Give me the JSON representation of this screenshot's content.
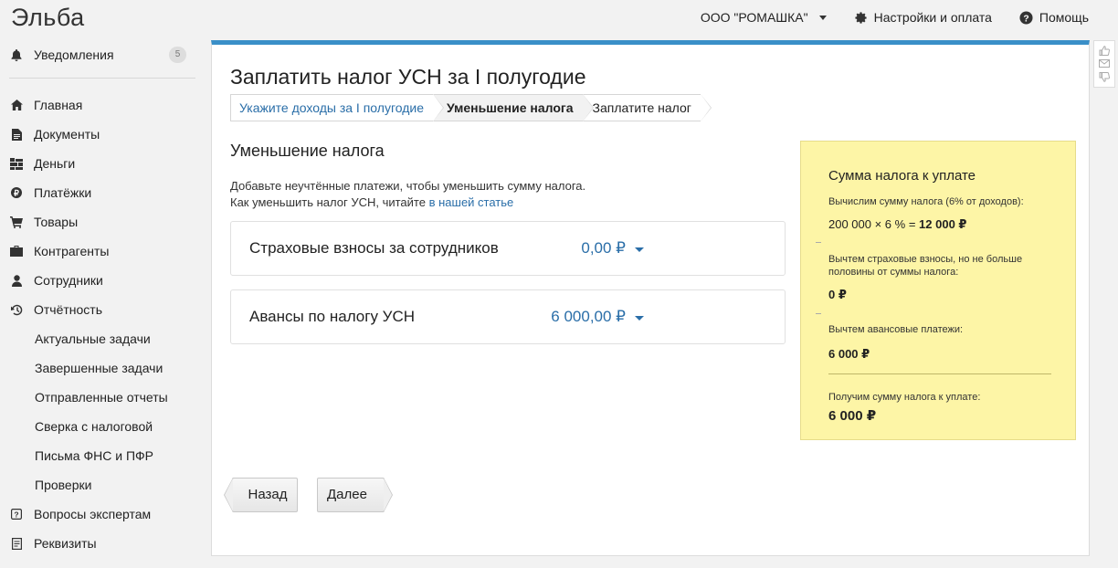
{
  "app": {
    "logo": "Эльба"
  },
  "topnav": {
    "org": "ООО \"РОМАШКА\"",
    "settings": "Настройки и оплата",
    "help": "Помощь"
  },
  "sidebar": {
    "notifications": {
      "label": "Уведомления",
      "badge": "5"
    },
    "items": [
      {
        "label": "Главная",
        "icon": "home-icon"
      },
      {
        "label": "Документы",
        "icon": "documents-icon"
      },
      {
        "label": "Деньги",
        "icon": "money-icon"
      },
      {
        "label": "Платёжки",
        "icon": "payments-icon"
      },
      {
        "label": "Товары",
        "icon": "cart-icon"
      },
      {
        "label": "Контрагенты",
        "icon": "briefcase-icon"
      },
      {
        "label": "Сотрудники",
        "icon": "person-icon"
      },
      {
        "label": "Отчётность",
        "icon": "report-icon"
      }
    ],
    "report_subitems": [
      "Актуальные задачи",
      "Завершенные задачи",
      "Отправленные отчеты",
      "Сверка с налоговой",
      "Письма ФНС и ПФР",
      "Проверки"
    ],
    "bottom_items": [
      {
        "label": "Вопросы экспертам",
        "icon": "question-icon"
      },
      {
        "label": "Реквизиты",
        "icon": "requisites-icon"
      }
    ]
  },
  "main": {
    "title": "Заплатить налог УСН за I полугодие",
    "steps": [
      "Укажите доходы за I полугодие",
      "Уменьшение налога",
      "Заплатите налог"
    ],
    "section_title": "Уменьшение налога",
    "hint_line1": "Добавьте неучтённые платежи, чтобы уменьшить сумму налога.",
    "hint_line2_prefix": "Как уменьшить налог УСН, читайте",
    "hint_link": "в нашей статье",
    "payments": [
      {
        "label": "Страховые взносы за сотрудников",
        "amount": "0,00 ₽"
      },
      {
        "label": "Авансы по налогу УСН",
        "amount": "6 000,00 ₽"
      }
    ],
    "buttons": {
      "back": "Назад",
      "next": "Далее"
    }
  },
  "summary": {
    "title": "Сумма налога к уплате",
    "calc_label": "Вычислим сумму налога (6% от доходов):",
    "formula_prefix": "200 000 × 6 % = ",
    "formula_result": "12 000 ₽",
    "insurance_label": "Вычтем страховые взносы, но не больше половины от суммы налога:",
    "insurance_value": "0 ₽",
    "advance_label": "Вычтем авансовые платежи:",
    "advance_value": "6 000 ₽",
    "total_label": "Получим сумму налога к уплате:",
    "total_value": "6 000 ₽"
  },
  "colors": {
    "accent": "#3a8fc8",
    "link": "#2a6ea8",
    "summary_bg": "#fdf5a6"
  }
}
